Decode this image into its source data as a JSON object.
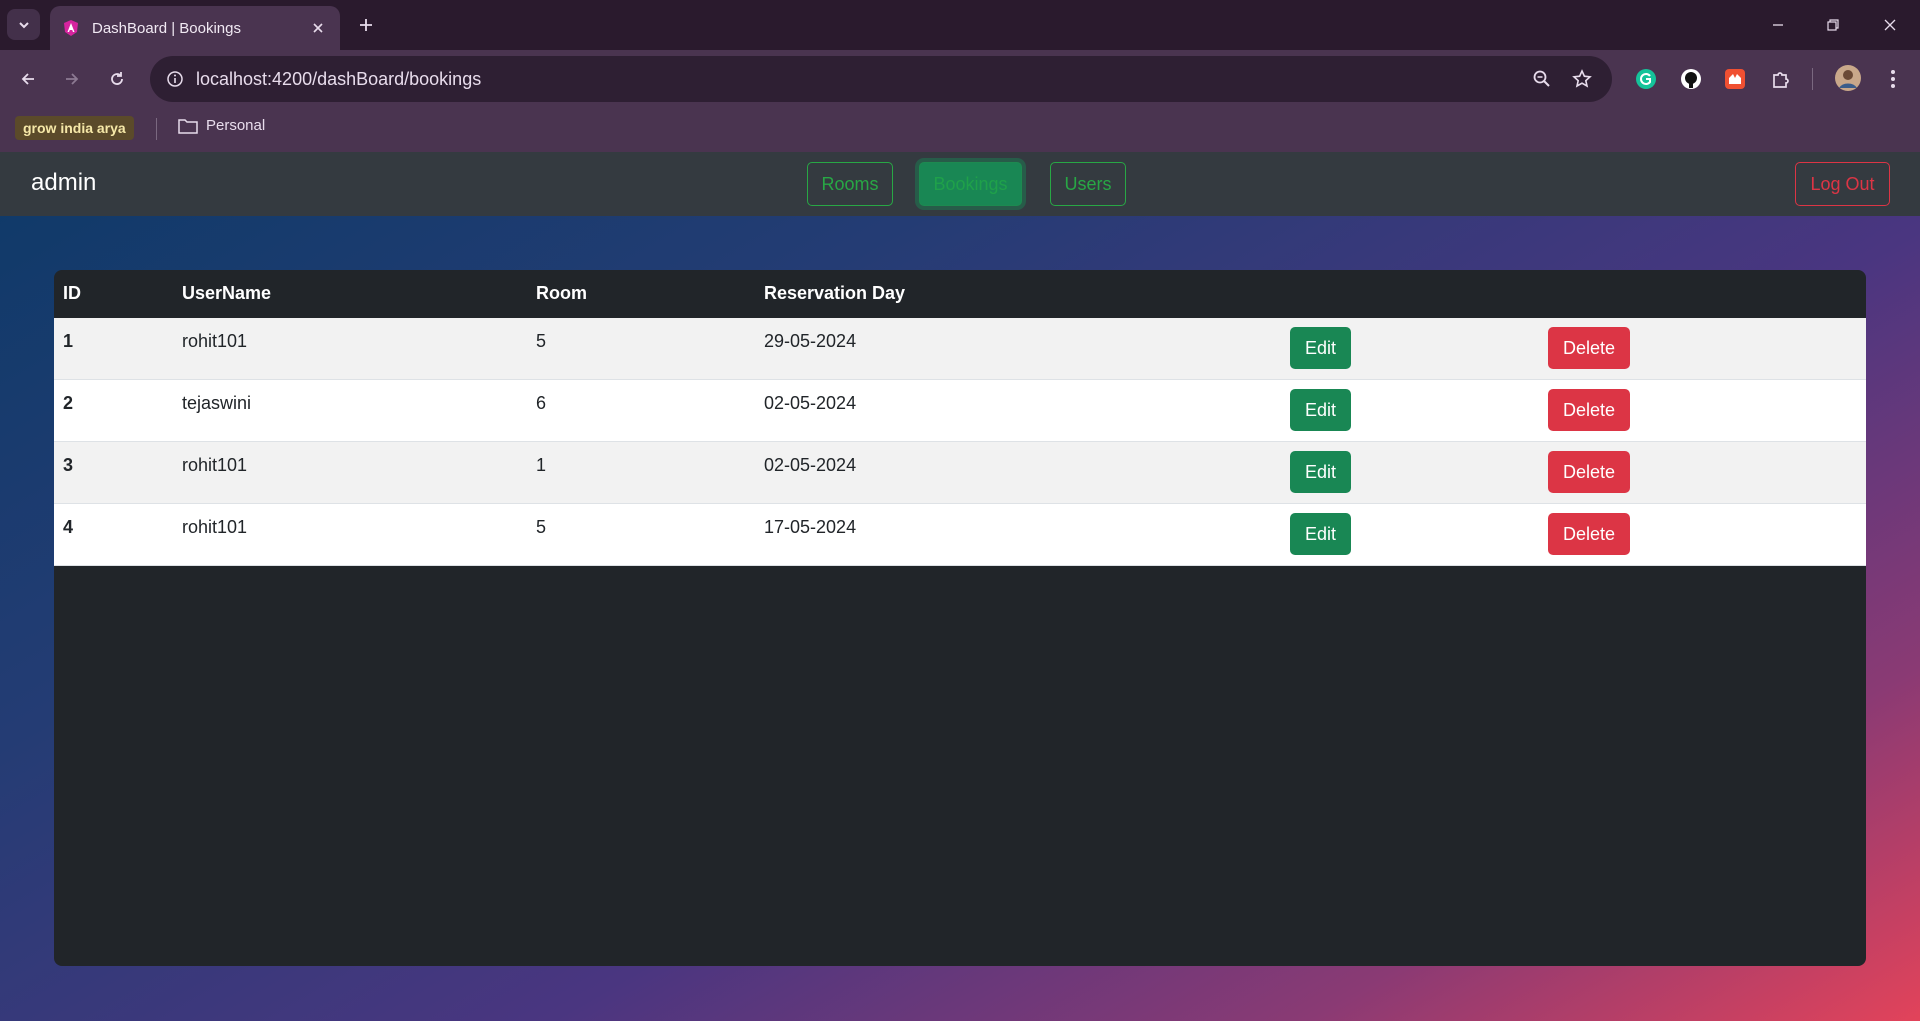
{
  "browser": {
    "tab_title": "DashBoard | Bookings",
    "url": "localhost:4200/dashBoard/bookings",
    "bookmarks": {
      "chip_label": "grow india arya",
      "folder_label": "Personal"
    }
  },
  "navbar": {
    "brand": "admin",
    "links": [
      "Rooms",
      "Bookings",
      "Users"
    ],
    "active_link": "Bookings",
    "logout_label": "Log Out"
  },
  "table": {
    "headers": [
      "ID",
      "UserName",
      "Room",
      "Reservation Day"
    ],
    "rows": [
      {
        "id": "1",
        "username": "rohit101",
        "room": "5",
        "day": "29-05-2024"
      },
      {
        "id": "2",
        "username": "tejaswini",
        "room": "6",
        "day": "02-05-2024"
      },
      {
        "id": "3",
        "username": "rohit101",
        "room": "1",
        "day": "02-05-2024"
      },
      {
        "id": "4",
        "username": "rohit101",
        "room": "5",
        "day": "17-05-2024"
      }
    ],
    "edit_label": "Edit",
    "delete_label": "Delete"
  },
  "colors": {
    "success": "#198754",
    "danger": "#dc3545",
    "navbar_bg": "#343a40",
    "table_dark": "#212529"
  }
}
